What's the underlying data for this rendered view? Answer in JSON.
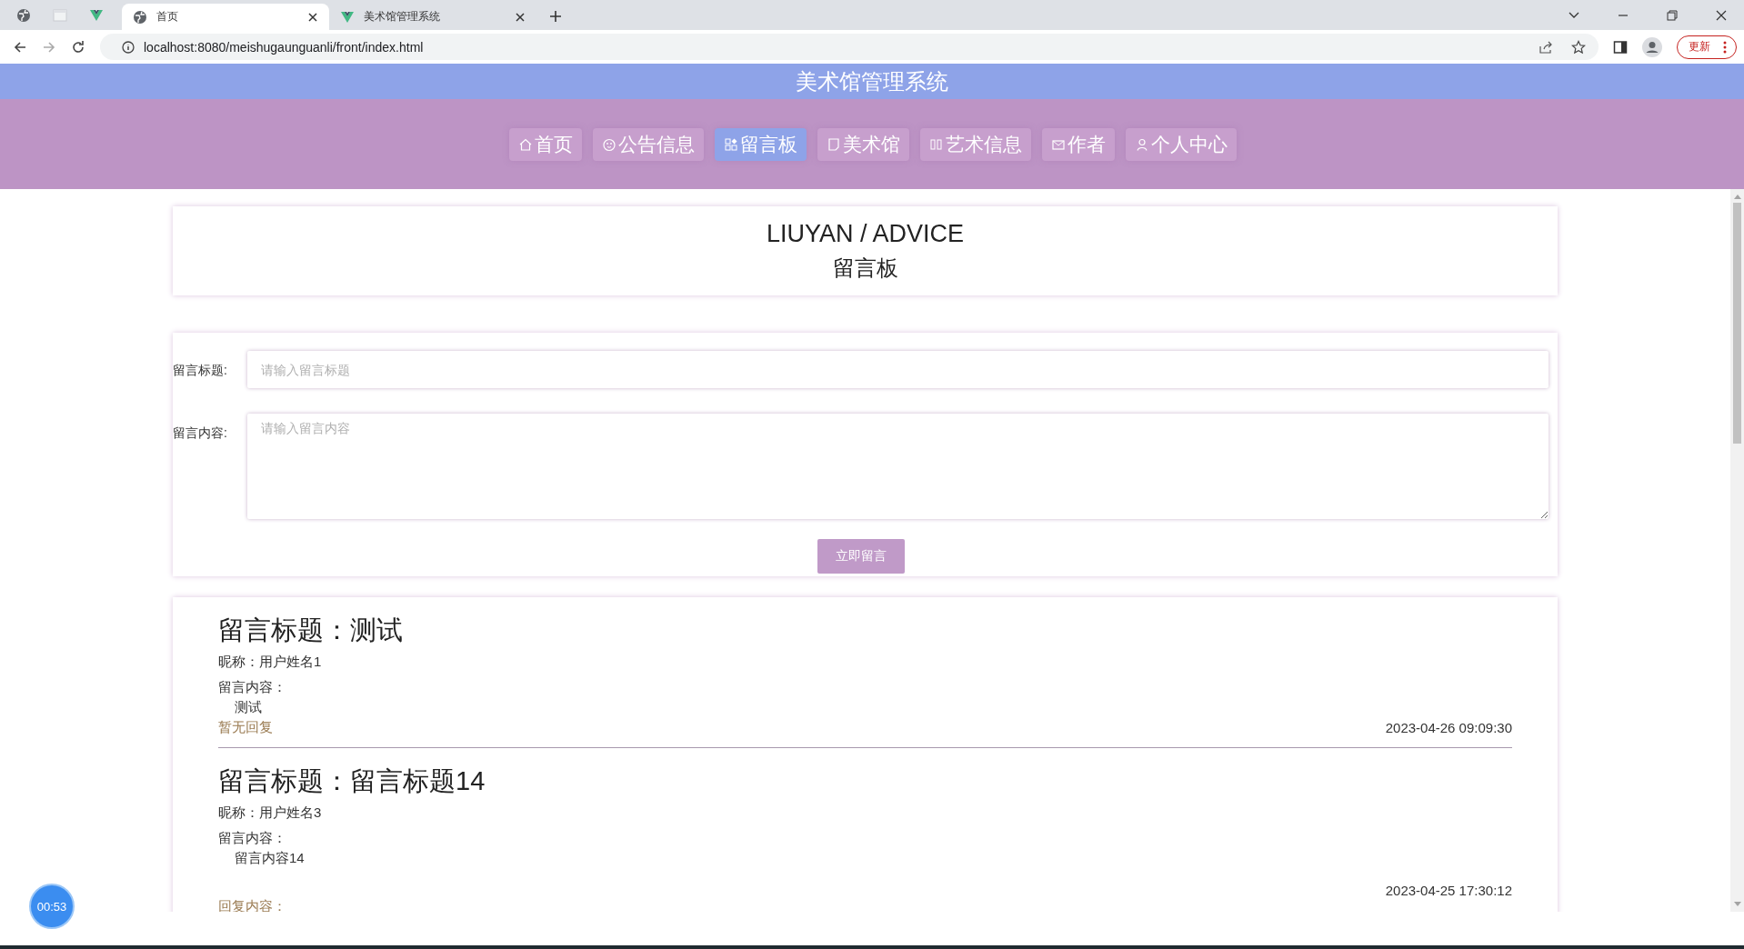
{
  "browser": {
    "tabs": [
      {
        "title": "首页",
        "selected": true
      },
      {
        "title": "美术馆管理系统",
        "selected": false
      }
    ],
    "url": "localhost:8080/meishugaunguanli/front/index.html",
    "update_button": "更新"
  },
  "site": {
    "title": "美术馆管理系统",
    "nav": [
      {
        "label": "首页",
        "selected": false
      },
      {
        "label": "公告信息",
        "selected": false
      },
      {
        "label": "留言板",
        "selected": true
      },
      {
        "label": "美术馆",
        "selected": false
      },
      {
        "label": "艺术信息",
        "selected": false
      },
      {
        "label": "作者",
        "selected": false
      },
      {
        "label": "个人中心",
        "selected": false
      }
    ]
  },
  "heading": {
    "en": "LIUYAN / ADVICE",
    "zh": "留言板"
  },
  "form": {
    "fields": [
      {
        "kind": "input",
        "label": "留言标题:",
        "placeholder": "请输入留言标题"
      },
      {
        "kind": "textarea",
        "label": "留言内容:",
        "placeholder": "请输入留言内容"
      }
    ],
    "submit": "立即留言"
  },
  "messages": [
    {
      "title": "留言标题：测试",
      "nickname": "昵称：用户姓名1",
      "content_label": "留言内容：",
      "content": "测试",
      "reply": {
        "kind": "none",
        "text": "暂无回复"
      },
      "date": "2023-04-26 09:09:30"
    },
    {
      "title": "留言标题：留言标题14",
      "nickname": "昵称：用户姓名3",
      "content_label": "留言内容：",
      "content": "留言内容14",
      "reply": {
        "kind": "reply",
        "text": "回复内容："
      },
      "date": "2023-04-25 17:30:12"
    }
  ],
  "recorder_timer": "00:53"
}
